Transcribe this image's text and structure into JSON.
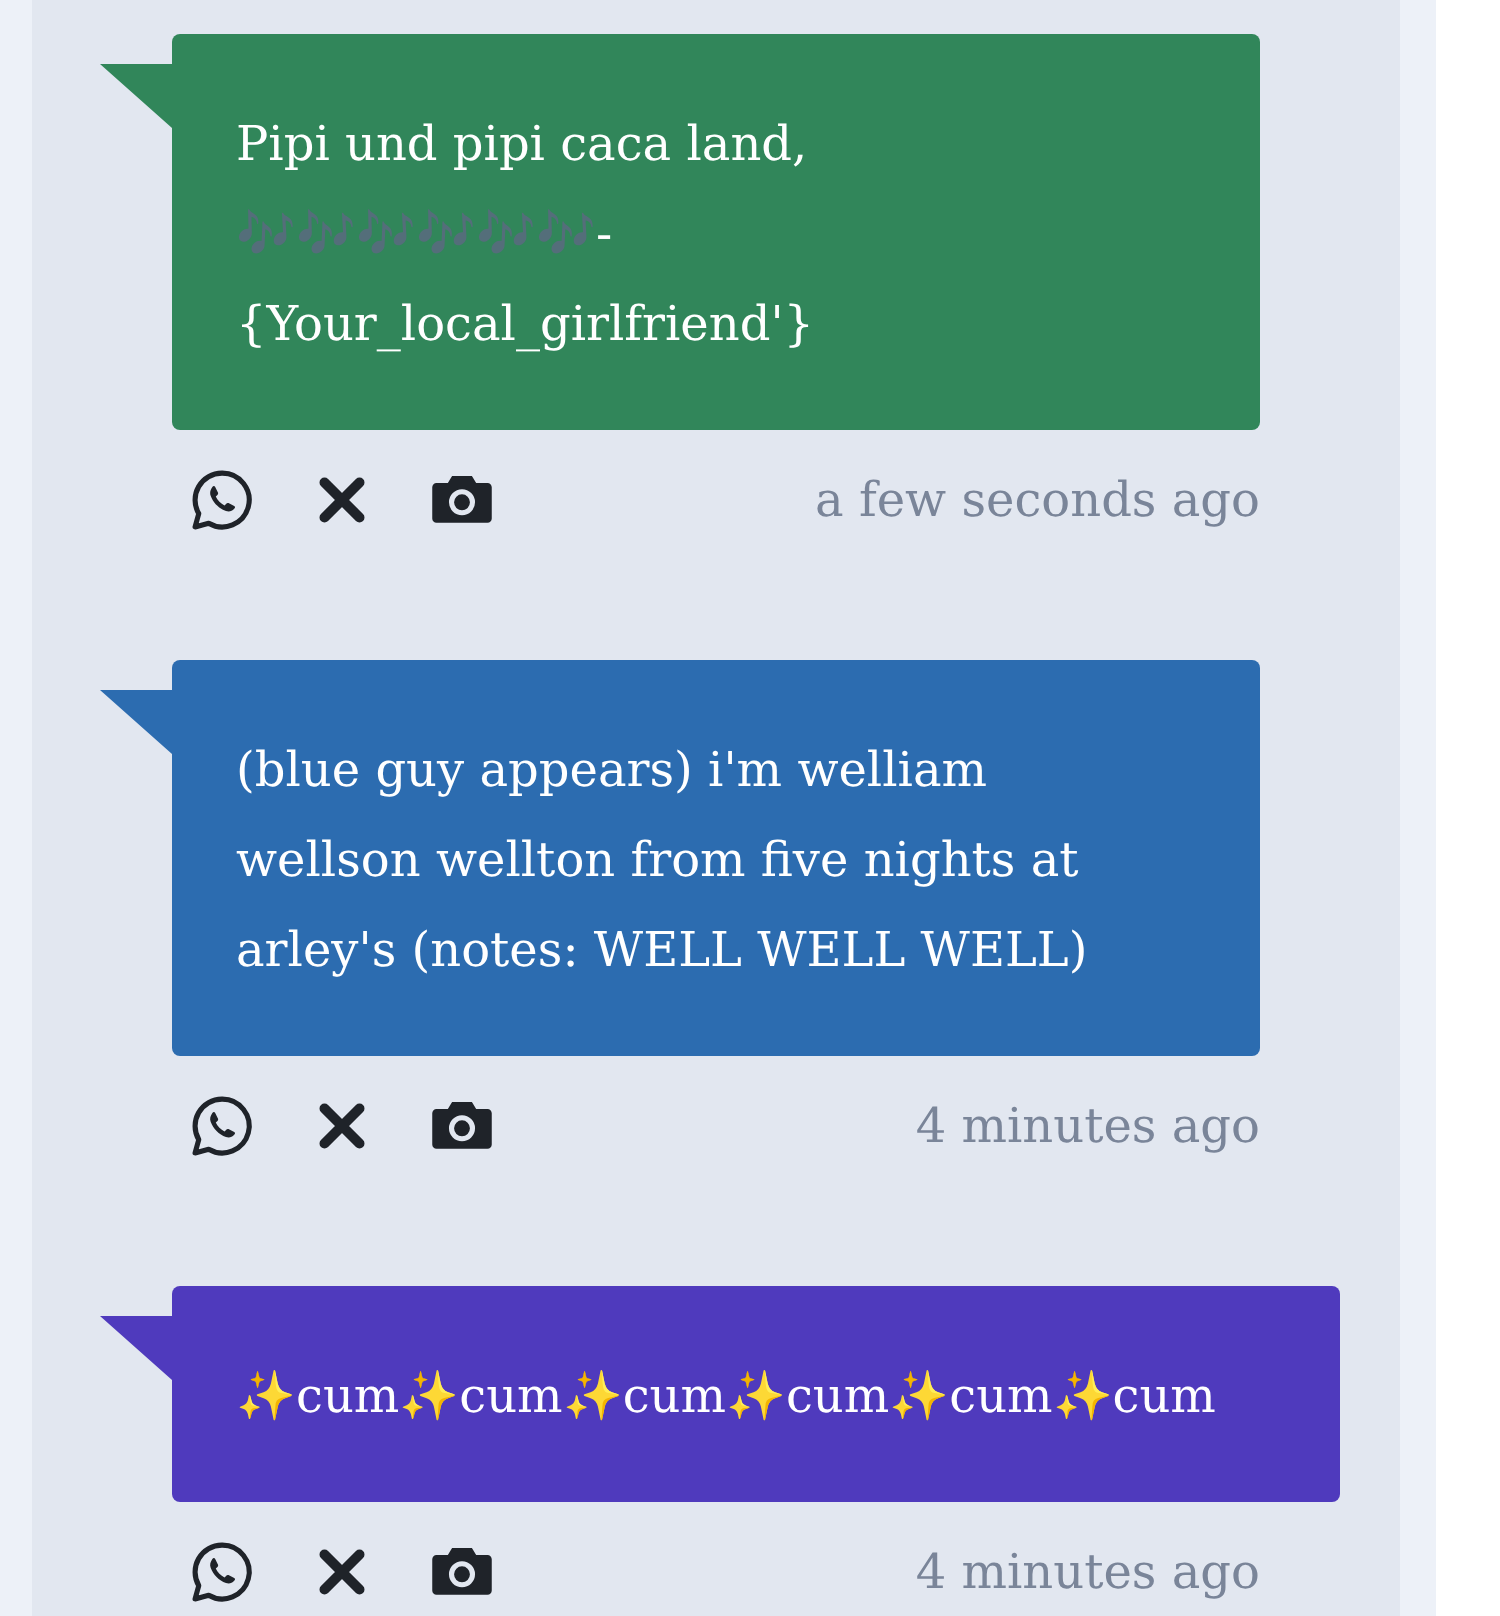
{
  "messages": [
    {
      "text": "Pipi und pipi caca land, 🎶🎶🎶🎶🎶🎶-{Your_local_girlfriend'}",
      "color": "#31865a",
      "time": "a few seconds ago"
    },
    {
      "text": "(blue guy appears) i'm welliam wellson wellton from five nights at arley's (notes: WELL WELL WELL)",
      "color": "#2c6cb0",
      "time": "4 minutes ago"
    },
    {
      "text": "✨cum✨cum✨cum✨cum✨cum✨cum",
      "color": "#4f3abd",
      "time": "4 minutes ago"
    }
  ]
}
